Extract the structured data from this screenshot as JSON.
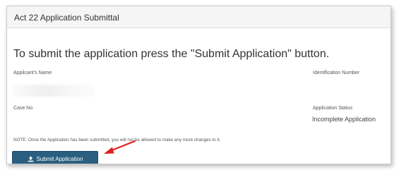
{
  "panel": {
    "title": "Act 22 Application Submittal"
  },
  "lead_text": "To submit the application press the \"Submit Application\" button.",
  "fields": {
    "applicant_name_label": "Applicant's Name",
    "identification_number_label": "Identification Number",
    "case_no_label": "Case No",
    "application_status_label": "Application Status",
    "application_status_value": "Incomplete Application"
  },
  "note": "NOTE: Once the Application has been submitted, you will not be allowed to make any more changes to it.",
  "submit_button": {
    "label": "Submit Application",
    "icon": "upload-icon"
  },
  "annotation": {
    "icon": "red-arrow-icon",
    "color": "#e02020"
  },
  "colors": {
    "button_bg": "#2a5f7f",
    "header_bg": "#f5f5f5"
  }
}
